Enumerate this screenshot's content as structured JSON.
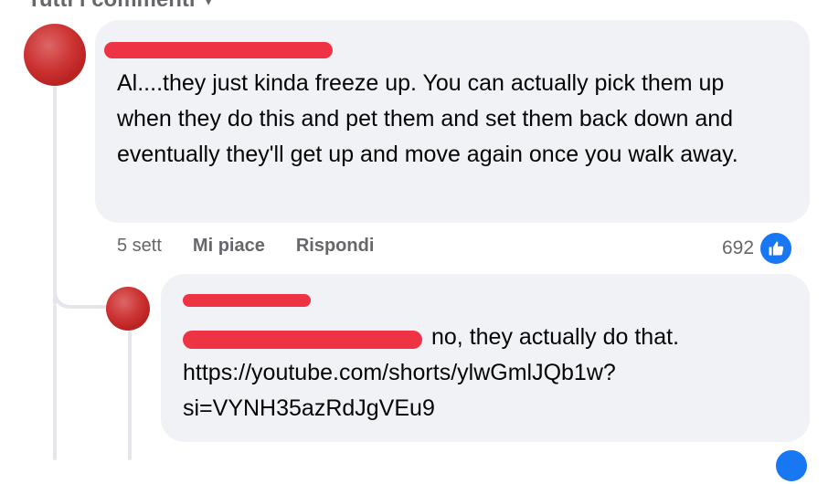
{
  "header": {
    "filter_label": "Tutti i commenti"
  },
  "comments": [
    {
      "text": "Al....they just kinda freeze up. You can actually pick them up when they do this and pet them and set them back down and eventually they'll get up and move again once you walk away.",
      "time": "5 sett",
      "like_label": "Mi piace",
      "reply_label": "Rispondi",
      "reaction_count": "692",
      "reaction_icon": "like-icon",
      "reaction_color": "#1877f2"
    }
  ],
  "reply": {
    "text_lines": [
      "no, they actually do that.",
      "https://youtube.com/shorts/ylwGmlJQb1w?",
      "si=VYNH35azRdJgVEu9"
    ]
  },
  "colors": {
    "bubble_bg": "#f0f2f5",
    "redaction": "#ee3344",
    "meta_text": "#65676b"
  }
}
